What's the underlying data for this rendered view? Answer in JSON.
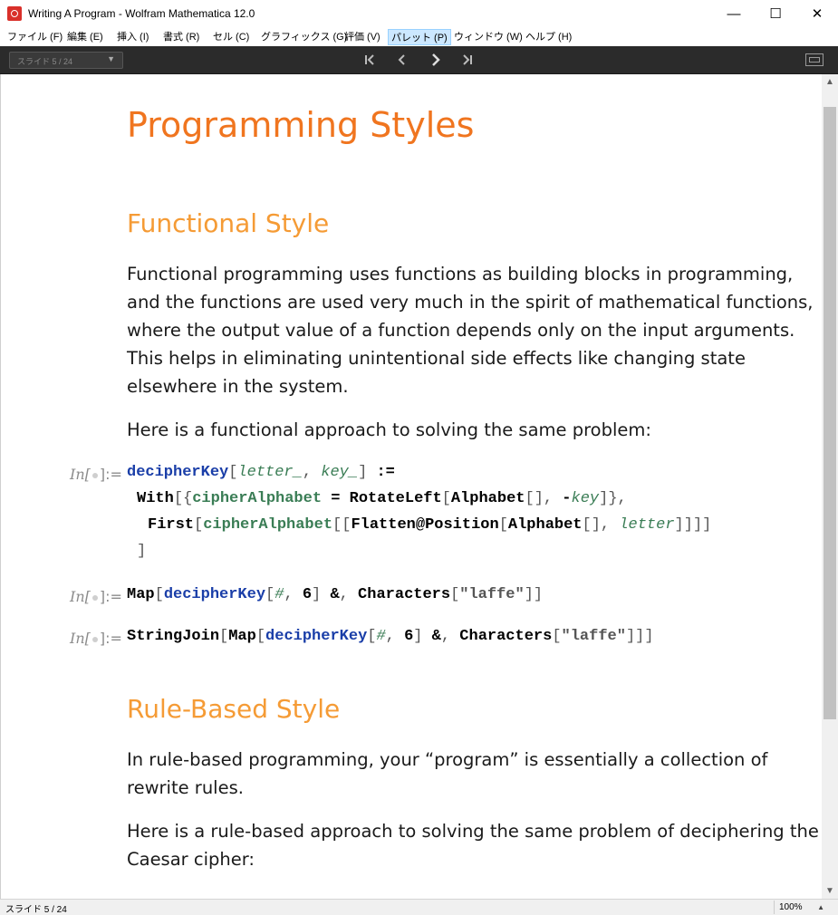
{
  "window": {
    "title": "Writing A Program - Wolfram Mathematica 12.0",
    "minimize": "—",
    "maximize": "☐",
    "close": "✕"
  },
  "menu": [
    {
      "label": "ファイル (F)"
    },
    {
      "label": "編集 (E)"
    },
    {
      "label": "挿入 (I)"
    },
    {
      "label": "書式 (R)"
    },
    {
      "label": "セル (C)"
    },
    {
      "label": "グラフィックス (G)"
    },
    {
      "label": "評価 (V)"
    },
    {
      "label": "パレット (P)"
    },
    {
      "label": "ウィンドウ (W)"
    },
    {
      "label": "ヘルプ (H)"
    }
  ],
  "toolbar": {
    "slide_selector": "スライド 5 / 24",
    "first": "⏮",
    "prev": "‹",
    "next": "›",
    "last": "⏭"
  },
  "notebook": {
    "title": "Programming Styles",
    "functional": {
      "heading": "Functional Style",
      "para1": [
        "Functional programming uses functions as building blocks in programming,",
        "and the functions are used very much in the spirit of mathematical functions,",
        "where the output value of a function depends only on the input arguments.",
        "This helps in eliminating unintentional side effects like changing state",
        "elsewhere in the system."
      ],
      "para2": "Here is a functional approach to solving the same problem:"
    },
    "input_label": "In[",
    "input_label_end": "]:=",
    "rule": {
      "heading": "Rule-Based Style",
      "para1": [
        "In rule-based programming, your “program” is essentially a collection of",
        "rewrite rules."
      ],
      "para2": [
        "Here is a rule-based approach to solving the same problem of deciphering the",
        "Caesar cipher:"
      ]
    }
  },
  "status": {
    "text": "スライド 5 / 24",
    "zoom": "100%"
  },
  "colors": {
    "title": "#f0751f",
    "heading": "#f59b35",
    "keyword": "#1a3ea8",
    "local_var": "#3a7d55"
  }
}
